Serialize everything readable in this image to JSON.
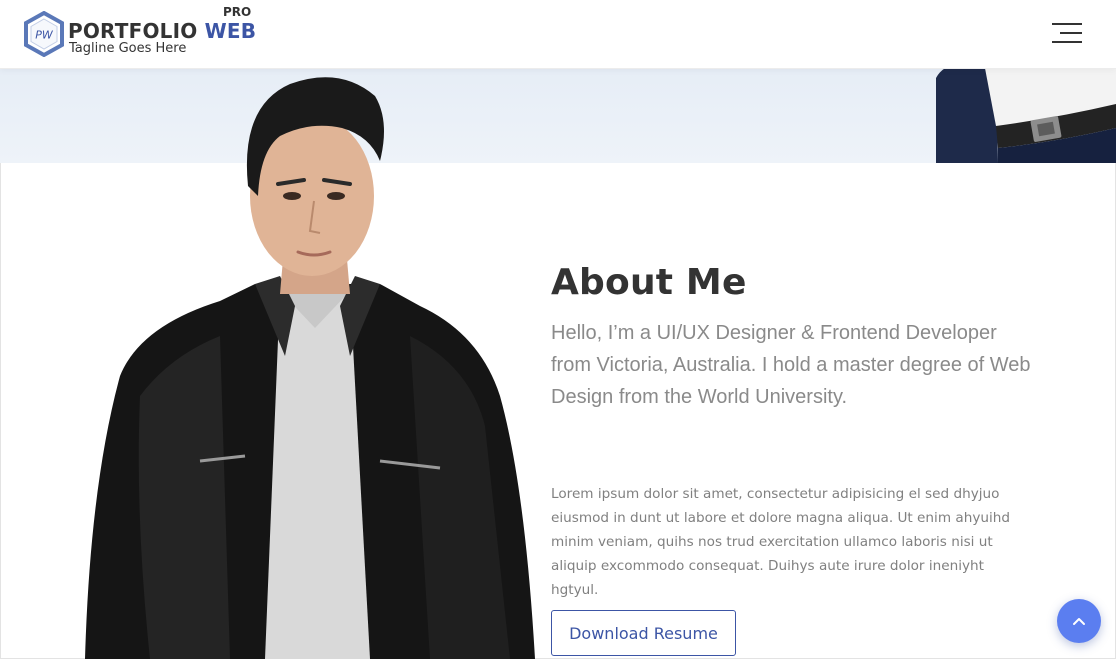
{
  "header": {
    "logo": {
      "badge_text": "PW",
      "title_main": "PORTFOLIO",
      "title_accent": "WEB",
      "pro_label": "PRO",
      "tagline": "Tagline Goes Here"
    },
    "menu_icon": "hamburger-icon"
  },
  "about": {
    "title": "About Me",
    "intro": "Hello, I’m a UI/UX Designer & Frontend Developer from Victoria, Australia. I hold a master degree of Web Design from the World University.",
    "body": "Lorem ipsum dolor sit amet, consectetur adipisicing el sed dhyjuo eiusmod in dunt ut labore et dolore magna aliqua. Ut enim ahyuihd minim veniam, quihs nos trud exercitation ullamco laboris nisi ut aliquip excommodo consequat. Duihys aute irure dolor ineniyht hgtyul.",
    "button_label": "Download Resume"
  },
  "scroll_top_icon": "chevron-up-icon",
  "colors": {
    "accent": "#3c55a5",
    "scroll_button": "#5b7ef0",
    "band": "#e9eff7",
    "heading": "#333333",
    "muted_text": "#8a8a8a"
  }
}
